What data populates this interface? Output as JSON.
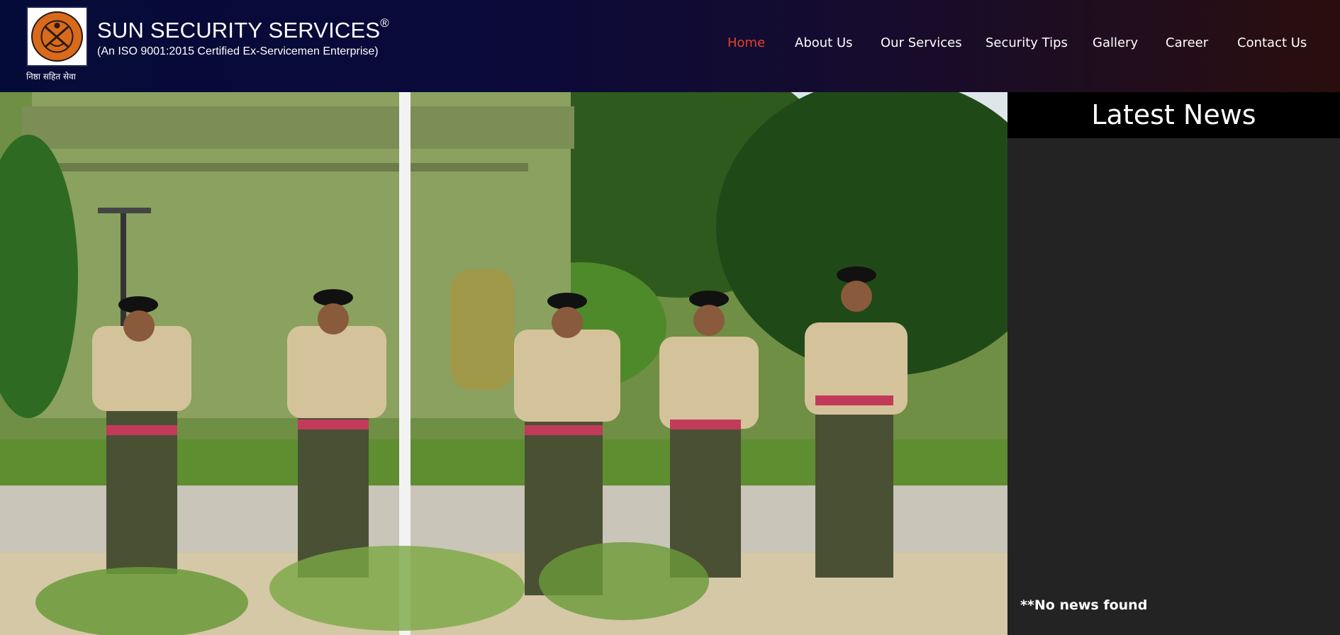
{
  "brand": {
    "title": "SUN SECURITY SERVICES",
    "registered_mark": "®",
    "subtitle": "(An ISO 9001:2015 Certified Ex-Servicemen Enterprise)",
    "tagline": "निष्ठा सहित सेवा",
    "logo_icon": "emblem-logo"
  },
  "nav": {
    "home": "Home",
    "about": "About Us",
    "services": "Our Services",
    "tips": "Security Tips",
    "gallery": "Gallery",
    "career": "Career",
    "contact": "Contact Us",
    "active": "Home"
  },
  "news": {
    "title": "Latest News",
    "empty_message": "**No news found"
  },
  "colors": {
    "header_start": "#050b38",
    "header_end": "#2a0e0e",
    "nav_active": "#e8402a",
    "news_panel": "#232323",
    "news_header": "#000000"
  }
}
